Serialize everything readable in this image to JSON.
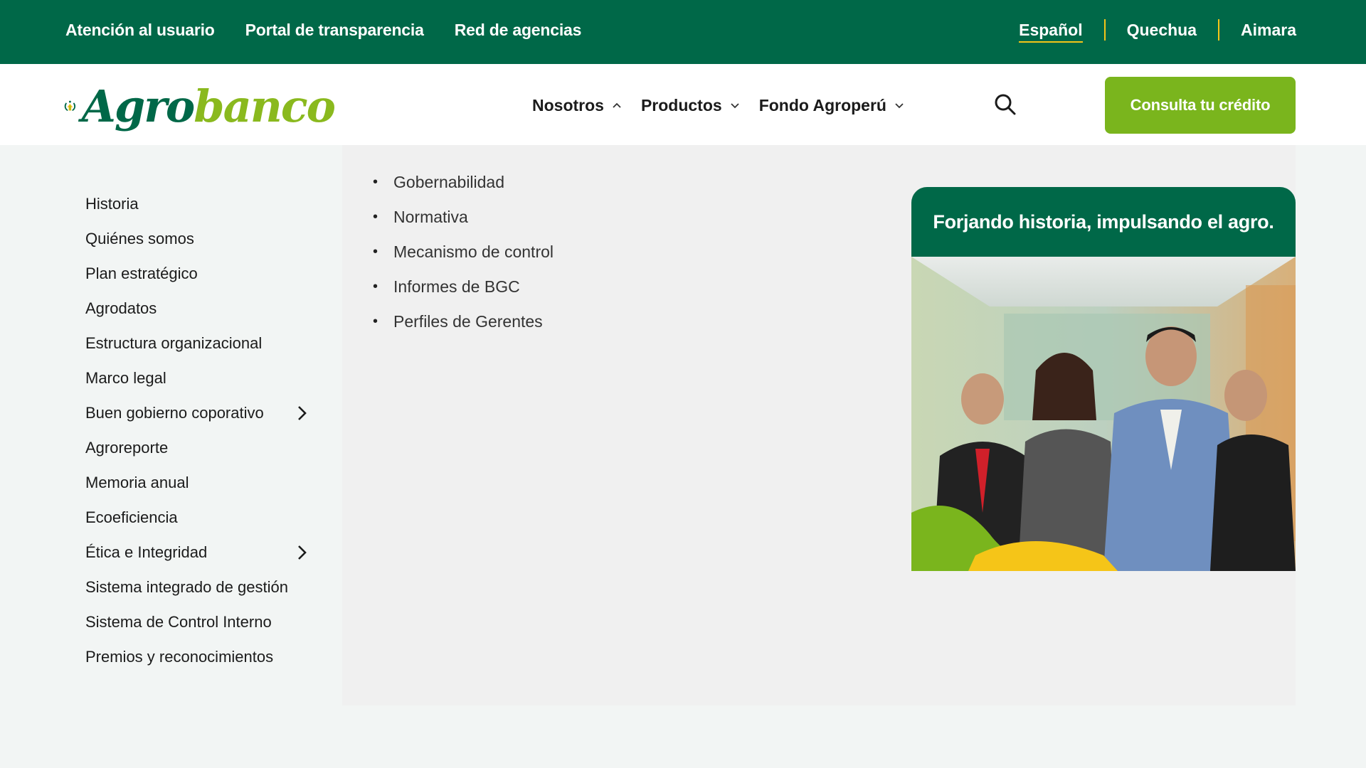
{
  "topbar": {
    "links": [
      "Atención al usuario",
      "Portal de transparencia",
      "Red de agencias"
    ],
    "languages": [
      {
        "label": "Español",
        "active": true
      },
      {
        "label": "Quechua",
        "active": false
      },
      {
        "label": "Aimara",
        "active": false
      }
    ]
  },
  "header": {
    "logo": {
      "part1": "Agro",
      "part2": "banco"
    },
    "nav": [
      {
        "label": "Nosotros",
        "icon": "chevron-up-icon"
      },
      {
        "label": "Productos",
        "icon": "chevron-down-icon"
      },
      {
        "label": "Fondo Agroperú",
        "icon": "chevron-down-icon"
      }
    ],
    "search_icon": "search-icon",
    "cta_label": "Consulta tu crédito"
  },
  "menu": {
    "items": [
      {
        "label": "Historia"
      },
      {
        "label": "Quiénes somos"
      },
      {
        "label": "Plan estratégico"
      },
      {
        "label": "Agrodatos"
      },
      {
        "label": "Estructura organizacional"
      },
      {
        "label": "Marco legal"
      },
      {
        "label": "Buen gobierno coporativo",
        "has_submenu": true
      },
      {
        "label": "Agroreporte"
      },
      {
        "label": "Memoria anual"
      },
      {
        "label": "Ecoeficiencia"
      },
      {
        "label": "Ética e Integridad",
        "has_submenu": true
      },
      {
        "label": "Sistema integrado de gestión"
      },
      {
        "label": "Sistema de Control Interno"
      },
      {
        "label": "Premios y reconocimientos"
      }
    ],
    "submenu": [
      "Gobernabilidad",
      "Normativa",
      "Mecanismo de control",
      "Informes de BGC",
      "Perfiles de Gerentes"
    ]
  },
  "promo": {
    "title": "Forjando historia, impulsando el agro."
  },
  "colors": {
    "brand_green": "#006848",
    "accent_green": "#7ab51d",
    "accent_yellow": "#f5c518"
  }
}
